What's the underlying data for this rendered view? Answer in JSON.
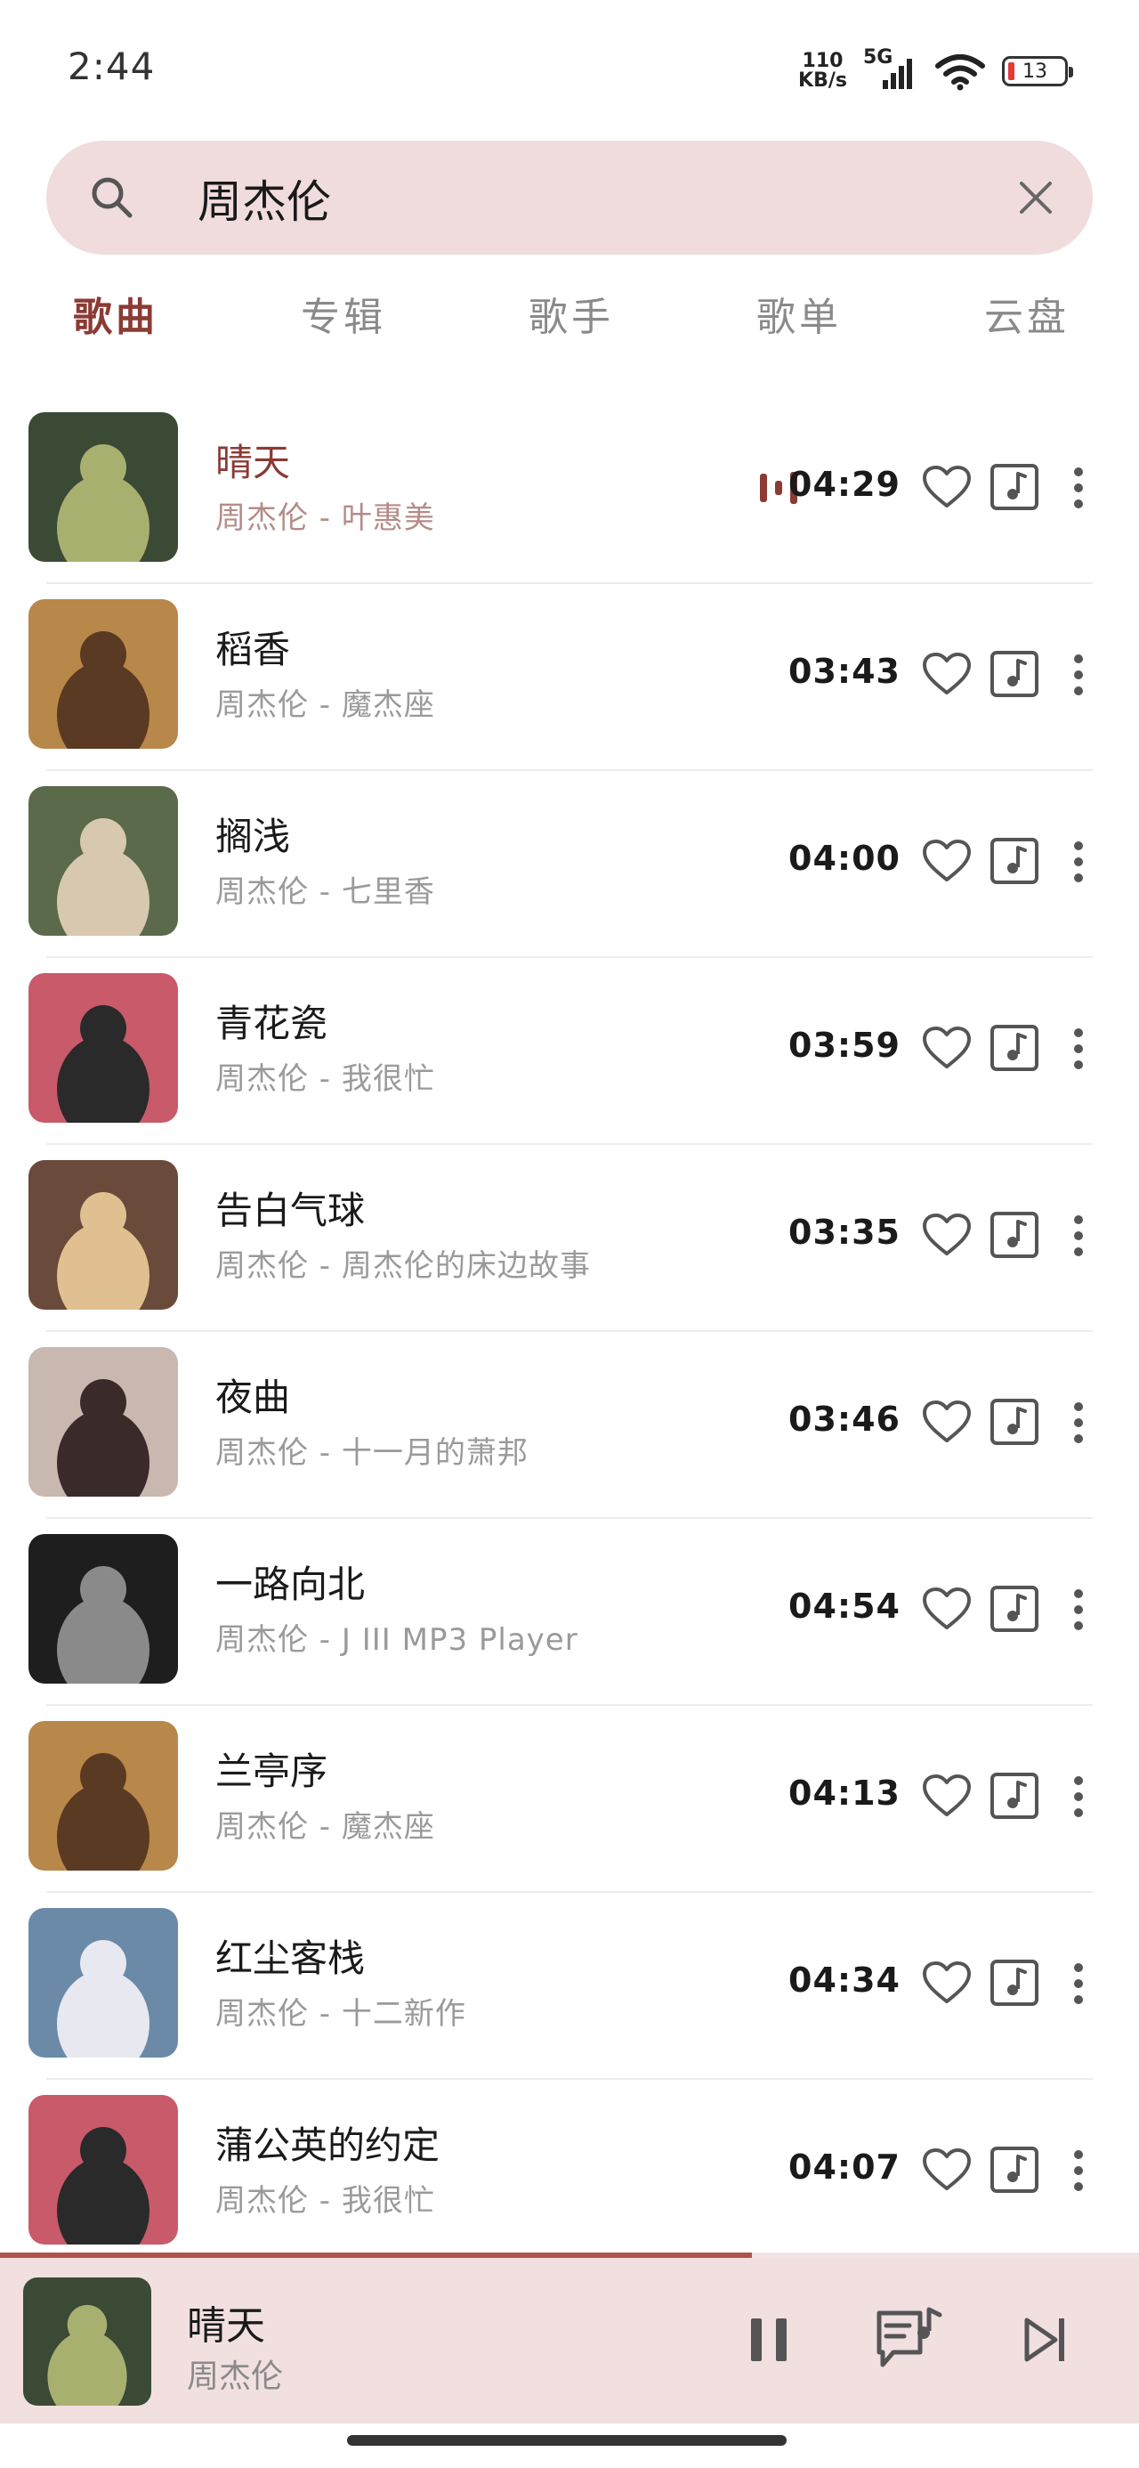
{
  "status_bar": {
    "time": "2:44",
    "net_speed_value": "110",
    "net_speed_unit": "KB/s",
    "network_type": "5G",
    "battery_level": "13"
  },
  "search": {
    "query": "周杰伦",
    "icon": "search-icon",
    "clear_icon": "close-icon"
  },
  "tabs": [
    {
      "label": "歌曲",
      "active": true
    },
    {
      "label": "专辑",
      "active": false
    },
    {
      "label": "歌手",
      "active": false
    },
    {
      "label": "歌单",
      "active": false
    },
    {
      "label": "云盘",
      "active": false
    }
  ],
  "songs": [
    {
      "title": "晴天",
      "subtitle": "周杰伦 - 叶惠美",
      "duration": "04:29",
      "playing": true
    },
    {
      "title": "稻香",
      "subtitle": "周杰伦 - 魔杰座",
      "duration": "03:43",
      "playing": false
    },
    {
      "title": "搁浅",
      "subtitle": "周杰伦 - 七里香",
      "duration": "04:00",
      "playing": false
    },
    {
      "title": "青花瓷",
      "subtitle": "周杰伦 - 我很忙",
      "duration": "03:59",
      "playing": false
    },
    {
      "title": "告白气球",
      "subtitle": "周杰伦 - 周杰伦的床边故事",
      "duration": "03:35",
      "playing": false
    },
    {
      "title": "夜曲",
      "subtitle": "周杰伦 - 十一月的萧邦",
      "duration": "03:46",
      "playing": false
    },
    {
      "title": "一路向北",
      "subtitle": "周杰伦 - J III MP3 Player",
      "duration": "04:54",
      "playing": false
    },
    {
      "title": "兰亭序",
      "subtitle": "周杰伦 - 魔杰座",
      "duration": "04:13",
      "playing": false
    },
    {
      "title": "红尘客栈",
      "subtitle": "周杰伦 - 十二新作",
      "duration": "04:34",
      "playing": false
    },
    {
      "title": "蒲公英的约定",
      "subtitle": "周杰伦 - 我很忙",
      "duration": "04:07",
      "playing": false
    }
  ],
  "now_playing": {
    "title": "晴天",
    "artist": "周杰伦",
    "progress": 0.66,
    "icons": [
      "pause-icon",
      "playlist-icon",
      "skip-next-icon"
    ]
  },
  "colors": {
    "accent": "#8b3a34",
    "search_bg": "#f0dcdc",
    "player_bg": "#f2e0e0",
    "progress": "#b0534b"
  },
  "covers": [
    {
      "bg": "#3b4a35",
      "fg": "#a8b070"
    },
    {
      "bg": "#b8874a",
      "fg": "#5a3a22"
    },
    {
      "bg": "#5a6a4a",
      "fg": "#d8c8b0"
    },
    {
      "bg": "#c85a6a",
      "fg": "#2a2a2a"
    },
    {
      "bg": "#6a4a3a",
      "fg": "#e0c090"
    },
    {
      "bg": "#c8b8b0",
      "fg": "#3a2a2a"
    },
    {
      "bg": "#1e1e1e",
      "fg": "#8a8a8a"
    },
    {
      "bg": "#b8874a",
      "fg": "#5a3a22"
    },
    {
      "bg": "#6a8aa8",
      "fg": "#e8e8f0"
    },
    {
      "bg": "#c85a6a",
      "fg": "#2a2a2a"
    }
  ]
}
